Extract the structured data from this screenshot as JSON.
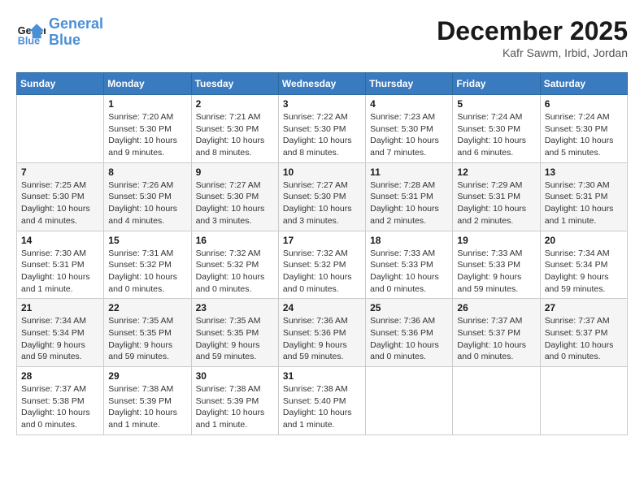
{
  "logo": {
    "line1": "General",
    "line2": "Blue"
  },
  "title": "December 2025",
  "subtitle": "Kafr Sawm, Irbid, Jordan",
  "weekdays": [
    "Sunday",
    "Monday",
    "Tuesday",
    "Wednesday",
    "Thursday",
    "Friday",
    "Saturday"
  ],
  "weeks": [
    [
      {
        "day": "",
        "info": ""
      },
      {
        "day": "1",
        "info": "Sunrise: 7:20 AM\nSunset: 5:30 PM\nDaylight: 10 hours\nand 9 minutes."
      },
      {
        "day": "2",
        "info": "Sunrise: 7:21 AM\nSunset: 5:30 PM\nDaylight: 10 hours\nand 8 minutes."
      },
      {
        "day": "3",
        "info": "Sunrise: 7:22 AM\nSunset: 5:30 PM\nDaylight: 10 hours\nand 8 minutes."
      },
      {
        "day": "4",
        "info": "Sunrise: 7:23 AM\nSunset: 5:30 PM\nDaylight: 10 hours\nand 7 minutes."
      },
      {
        "day": "5",
        "info": "Sunrise: 7:24 AM\nSunset: 5:30 PM\nDaylight: 10 hours\nand 6 minutes."
      },
      {
        "day": "6",
        "info": "Sunrise: 7:24 AM\nSunset: 5:30 PM\nDaylight: 10 hours\nand 5 minutes."
      }
    ],
    [
      {
        "day": "7",
        "info": "Sunrise: 7:25 AM\nSunset: 5:30 PM\nDaylight: 10 hours\nand 4 minutes."
      },
      {
        "day": "8",
        "info": "Sunrise: 7:26 AM\nSunset: 5:30 PM\nDaylight: 10 hours\nand 4 minutes."
      },
      {
        "day": "9",
        "info": "Sunrise: 7:27 AM\nSunset: 5:30 PM\nDaylight: 10 hours\nand 3 minutes."
      },
      {
        "day": "10",
        "info": "Sunrise: 7:27 AM\nSunset: 5:30 PM\nDaylight: 10 hours\nand 3 minutes."
      },
      {
        "day": "11",
        "info": "Sunrise: 7:28 AM\nSunset: 5:31 PM\nDaylight: 10 hours\nand 2 minutes."
      },
      {
        "day": "12",
        "info": "Sunrise: 7:29 AM\nSunset: 5:31 PM\nDaylight: 10 hours\nand 2 minutes."
      },
      {
        "day": "13",
        "info": "Sunrise: 7:30 AM\nSunset: 5:31 PM\nDaylight: 10 hours\nand 1 minute."
      }
    ],
    [
      {
        "day": "14",
        "info": "Sunrise: 7:30 AM\nSunset: 5:31 PM\nDaylight: 10 hours\nand 1 minute."
      },
      {
        "day": "15",
        "info": "Sunrise: 7:31 AM\nSunset: 5:32 PM\nDaylight: 10 hours\nand 0 minutes."
      },
      {
        "day": "16",
        "info": "Sunrise: 7:32 AM\nSunset: 5:32 PM\nDaylight: 10 hours\nand 0 minutes."
      },
      {
        "day": "17",
        "info": "Sunrise: 7:32 AM\nSunset: 5:32 PM\nDaylight: 10 hours\nand 0 minutes."
      },
      {
        "day": "18",
        "info": "Sunrise: 7:33 AM\nSunset: 5:33 PM\nDaylight: 10 hours\nand 0 minutes."
      },
      {
        "day": "19",
        "info": "Sunrise: 7:33 AM\nSunset: 5:33 PM\nDaylight: 9 hours\nand 59 minutes."
      },
      {
        "day": "20",
        "info": "Sunrise: 7:34 AM\nSunset: 5:34 PM\nDaylight: 9 hours\nand 59 minutes."
      }
    ],
    [
      {
        "day": "21",
        "info": "Sunrise: 7:34 AM\nSunset: 5:34 PM\nDaylight: 9 hours\nand 59 minutes."
      },
      {
        "day": "22",
        "info": "Sunrise: 7:35 AM\nSunset: 5:35 PM\nDaylight: 9 hours\nand 59 minutes."
      },
      {
        "day": "23",
        "info": "Sunrise: 7:35 AM\nSunset: 5:35 PM\nDaylight: 9 hours\nand 59 minutes."
      },
      {
        "day": "24",
        "info": "Sunrise: 7:36 AM\nSunset: 5:36 PM\nDaylight: 9 hours\nand 59 minutes."
      },
      {
        "day": "25",
        "info": "Sunrise: 7:36 AM\nSunset: 5:36 PM\nDaylight: 10 hours\nand 0 minutes."
      },
      {
        "day": "26",
        "info": "Sunrise: 7:37 AM\nSunset: 5:37 PM\nDaylight: 10 hours\nand 0 minutes."
      },
      {
        "day": "27",
        "info": "Sunrise: 7:37 AM\nSunset: 5:37 PM\nDaylight: 10 hours\nand 0 minutes."
      }
    ],
    [
      {
        "day": "28",
        "info": "Sunrise: 7:37 AM\nSunset: 5:38 PM\nDaylight: 10 hours\nand 0 minutes."
      },
      {
        "day": "29",
        "info": "Sunrise: 7:38 AM\nSunset: 5:39 PM\nDaylight: 10 hours\nand 1 minute."
      },
      {
        "day": "30",
        "info": "Sunrise: 7:38 AM\nSunset: 5:39 PM\nDaylight: 10 hours\nand 1 minute."
      },
      {
        "day": "31",
        "info": "Sunrise: 7:38 AM\nSunset: 5:40 PM\nDaylight: 10 hours\nand 1 minute."
      },
      {
        "day": "",
        "info": ""
      },
      {
        "day": "",
        "info": ""
      },
      {
        "day": "",
        "info": ""
      }
    ]
  ]
}
